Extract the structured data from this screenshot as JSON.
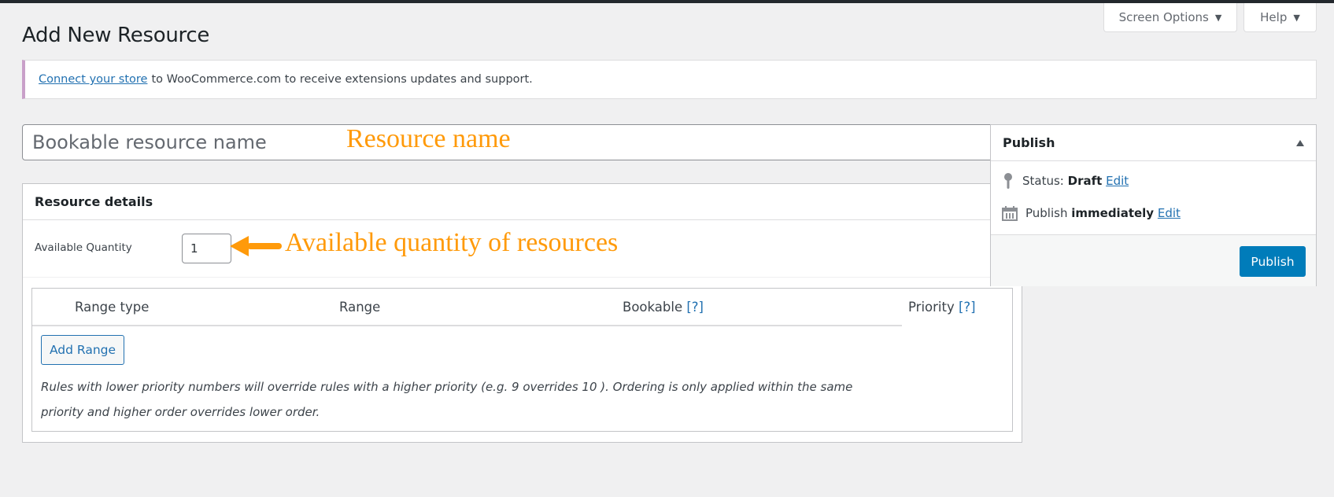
{
  "header": {
    "screen_options_label": "Screen Options",
    "help_label": "Help",
    "page_title": "Add New Resource"
  },
  "notice": {
    "link_text": "Connect your store",
    "text": "to WooCommerce.com to receive extensions updates and support.",
    "accent_color": "#c9a0c9"
  },
  "title_field": {
    "placeholder": "Bookable resource name",
    "value": ""
  },
  "annotations": {
    "resource_name": "Resource name",
    "available_quantity": "Available quantity of resources",
    "color": "#ff9a0a"
  },
  "resource_details": {
    "title": "Resource details",
    "quantity_label": "Available Quantity",
    "quantity_value": "1",
    "table": {
      "columns": [
        {
          "label": "Range type",
          "help": ""
        },
        {
          "label": "Range",
          "help": ""
        },
        {
          "label": "Bookable",
          "help": "[?]"
        },
        {
          "label": "Priority",
          "help": "[?]"
        }
      ],
      "rows": []
    },
    "add_range_label": "Add Range",
    "rules_text": "Rules with lower priority numbers will override rules with a higher priority (e.g. 9 overrides 10 ). Ordering is only applied within the same priority and higher order overrides lower order."
  },
  "publish_box": {
    "title": "Publish",
    "status_label": "Status:",
    "status_value": "Draft",
    "status_edit": "Edit",
    "schedule_label": "Publish",
    "schedule_value": "immediately",
    "schedule_edit": "Edit",
    "publish_button": "Publish",
    "button_color": "#007cba"
  }
}
